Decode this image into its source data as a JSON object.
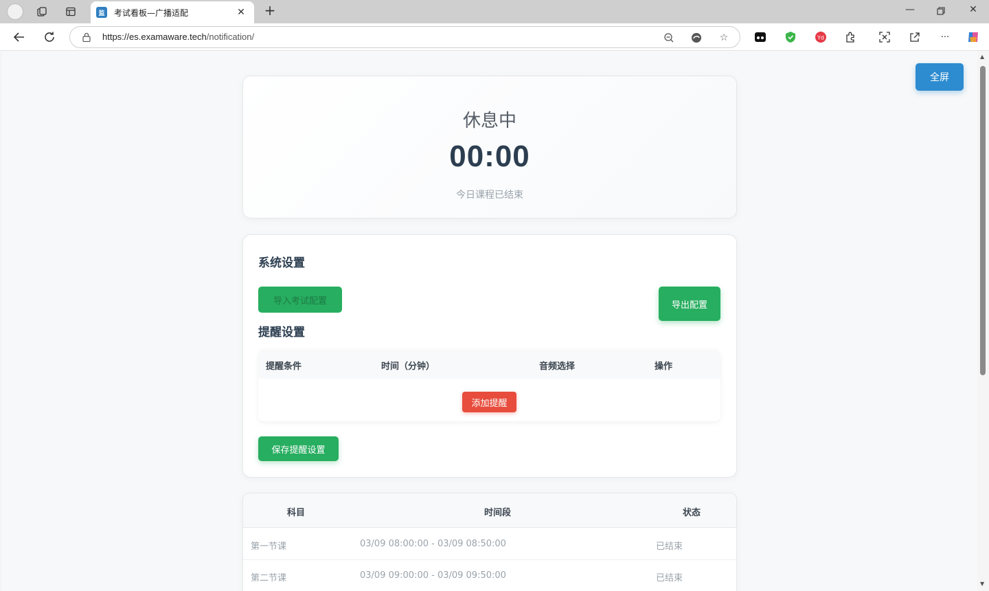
{
  "browser": {
    "tab_title": "考试看板—广播适配",
    "favicon_text": "监",
    "url_host": "https://es.examaware.tech",
    "url_path": "/notification/"
  },
  "page": {
    "fullscreen_label": "全屏",
    "status": {
      "title": "休息中",
      "time": "00:00",
      "subtitle": "今日课程已结束"
    },
    "system_settings": {
      "title": "系统设置",
      "import_label": "导入考试配置",
      "export_label": "导出配置"
    },
    "reminder_settings": {
      "title": "提醒设置",
      "columns": [
        "提醒条件",
        "时间（分钟）",
        "音频选择",
        "操作"
      ],
      "add_label": "添加提醒",
      "save_label": "保存提醒设置"
    },
    "schedule": {
      "columns": [
        "科目",
        "时间段",
        "状态"
      ],
      "rows": [
        {
          "subject": "第一节课",
          "period": "03/09 08:00:00 - 03/09 08:50:00",
          "status": "已结束"
        },
        {
          "subject": "第二节课",
          "period": "03/09 09:00:00 - 03/09 09:50:00",
          "status": "已结束"
        }
      ]
    }
  },
  "colors": {
    "primary_blue": "#2d8bd0",
    "green": "#27ae60",
    "red": "#e74c3c",
    "heading": "#2c3e50"
  }
}
